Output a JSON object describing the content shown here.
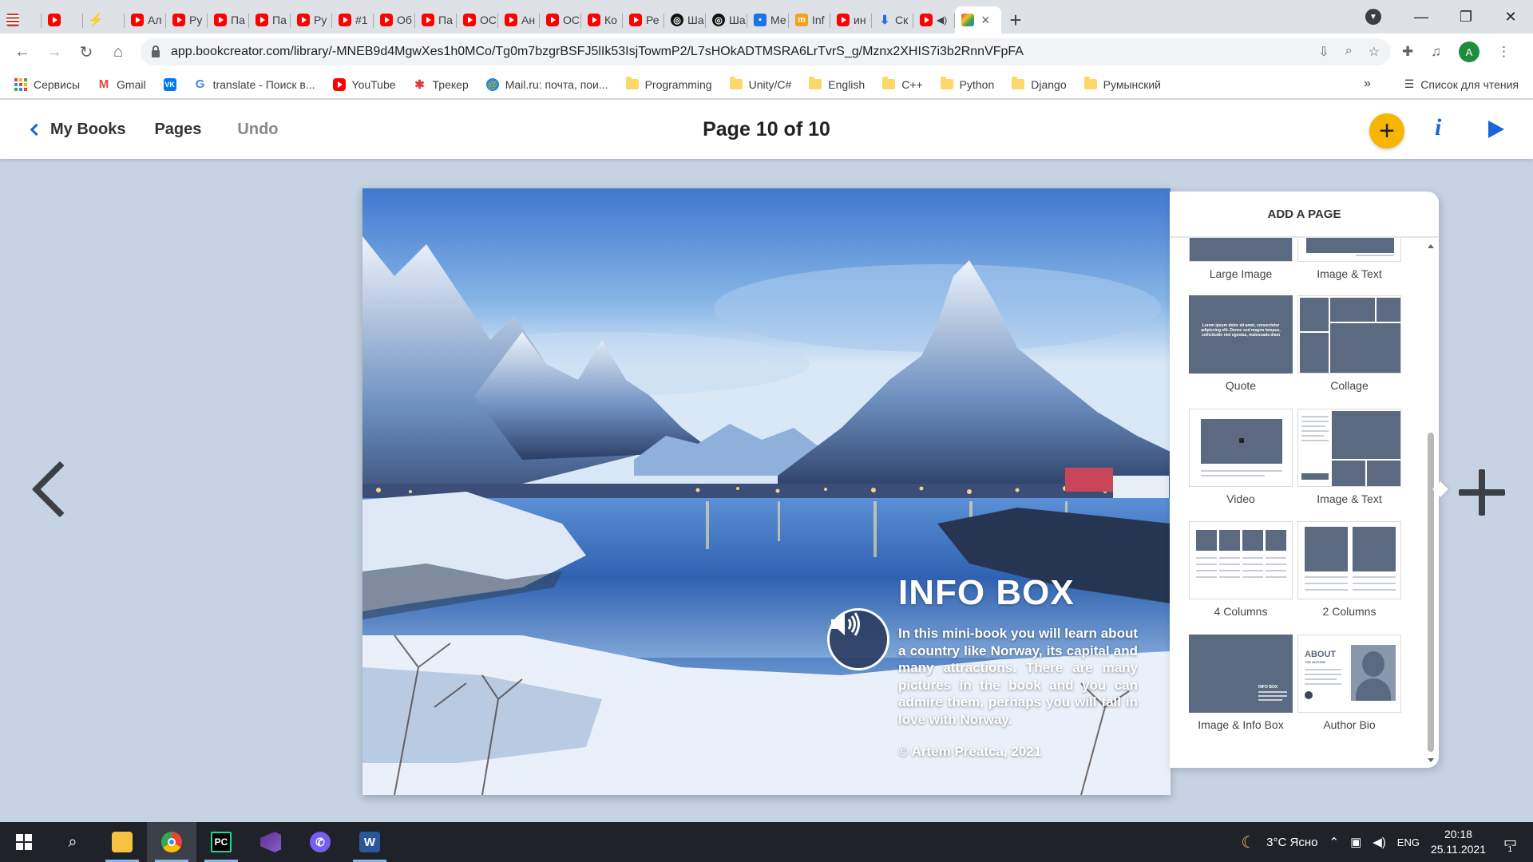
{
  "browser": {
    "tabs": [
      {
        "icon": "us-flag-icon",
        "title": ""
      },
      {
        "icon": "youtube-icon",
        "title": ""
      },
      {
        "icon": "lightning-icon",
        "title": ""
      },
      {
        "icon": "youtube-icon",
        "title": "Ал"
      },
      {
        "icon": "youtube-icon",
        "title": "Py"
      },
      {
        "icon": "youtube-icon",
        "title": "Па"
      },
      {
        "icon": "youtube-icon",
        "title": "Па"
      },
      {
        "icon": "youtube-icon",
        "title": "Py"
      },
      {
        "icon": "youtube-icon",
        "title": "#1"
      },
      {
        "icon": "youtube-icon",
        "title": "Об"
      },
      {
        "icon": "youtube-icon",
        "title": "Па"
      },
      {
        "icon": "youtube-icon",
        "title": "ОС"
      },
      {
        "icon": "youtube-icon",
        "title": "Ан"
      },
      {
        "icon": "youtube-icon",
        "title": "ОС"
      },
      {
        "icon": "youtube-icon",
        "title": "Ко"
      },
      {
        "icon": "youtube-icon",
        "title": "Ре"
      },
      {
        "icon": "openai-icon",
        "title": "Ша"
      },
      {
        "icon": "openai-icon",
        "title": "Ша"
      },
      {
        "icon": "messenger-icon",
        "title": "Ме"
      },
      {
        "icon": "informatics-icon",
        "title": "Inf"
      },
      {
        "icon": "youtube-icon",
        "title": "ин"
      },
      {
        "icon": "download-icon",
        "title": "Ск"
      },
      {
        "icon": "youtube-icon",
        "title": ""
      }
    ],
    "active_tab_close": "×",
    "new_tab": "+",
    "url": "app.bookcreator.com/library/-MNEB9d4MgwXes1h0MCo/Tg0m7bzgrBSFJ5lIk53IsjTowmP2/L7sHOkADTMSRA6LrTvrS_g/Mznx2XHIS7i3b2RnnVFpFA",
    "profile_initial": "A",
    "bookmarks": [
      {
        "icon": "apps-icon",
        "label": "Сервисы"
      },
      {
        "icon": "gmail-icon",
        "label": "Gmail"
      },
      {
        "icon": "vk-icon",
        "label": ""
      },
      {
        "icon": "google-icon",
        "label": "translate - Поиск в..."
      },
      {
        "icon": "youtube-icon",
        "label": "YouTube"
      },
      {
        "icon": "tracker-icon",
        "label": "Трекер"
      },
      {
        "icon": "mailru-icon",
        "label": "Mail.ru: почта, пои..."
      },
      {
        "icon": "folder-icon",
        "label": "Programming"
      },
      {
        "icon": "folder-icon",
        "label": "Unity/C#"
      },
      {
        "icon": "folder-icon",
        "label": "English"
      },
      {
        "icon": "folder-icon",
        "label": "C++"
      },
      {
        "icon": "folder-icon",
        "label": "Python"
      },
      {
        "icon": "folder-icon",
        "label": "Django"
      },
      {
        "icon": "folder-icon",
        "label": "Румынский"
      }
    ],
    "bookmarks_more": "»",
    "reading_list": "Список для чтения"
  },
  "header": {
    "my_books": "My Books",
    "pages": "Pages",
    "undo": "Undo",
    "page_title": "Page 10 of 10",
    "add_label": "+",
    "info_label": "i"
  },
  "page": {
    "info_title": "INFO BOX",
    "info_body": "In this mini-book you will learn about a country like Norway, its capital and many attractions. There are many pictures in the book and you can admire them, perhaps you will fall in love with Norway.",
    "info_credit": "© Artem Preatca, 2021"
  },
  "add_page_panel": {
    "title": "ADD A PAGE",
    "templates": [
      {
        "label": "Large Image"
      },
      {
        "label": "Image & Text"
      },
      {
        "label": "Quote",
        "quote_text": "Lorem ipsum dolor sit amet, consectetur adipiscing elit. Donec sed magna tempus, sollicitudin nisl egestas, malesuada diam"
      },
      {
        "label": "Collage"
      },
      {
        "label": "Video"
      },
      {
        "label": "Image & Text"
      },
      {
        "label": "4 Columns"
      },
      {
        "label": "2 Columns"
      },
      {
        "label": "Image & Info Box",
        "mini_title": "INFO BOX"
      },
      {
        "label": "Author Bio",
        "about_title": "ABOUT",
        "about_sub": "THE AUTHOR"
      }
    ]
  },
  "taskbar": {
    "apps": [
      {
        "icon": "file-explorer-icon"
      },
      {
        "icon": "chrome-icon"
      },
      {
        "icon": "pycharm-icon",
        "label": "PC"
      },
      {
        "icon": "visual-studio-icon"
      },
      {
        "icon": "viber-icon"
      },
      {
        "icon": "word-icon",
        "label": "W"
      }
    ],
    "weather": "3°C Ясно",
    "language": "ENG",
    "time": "20:18",
    "date": "25.11.2021",
    "notifications": "1"
  }
}
